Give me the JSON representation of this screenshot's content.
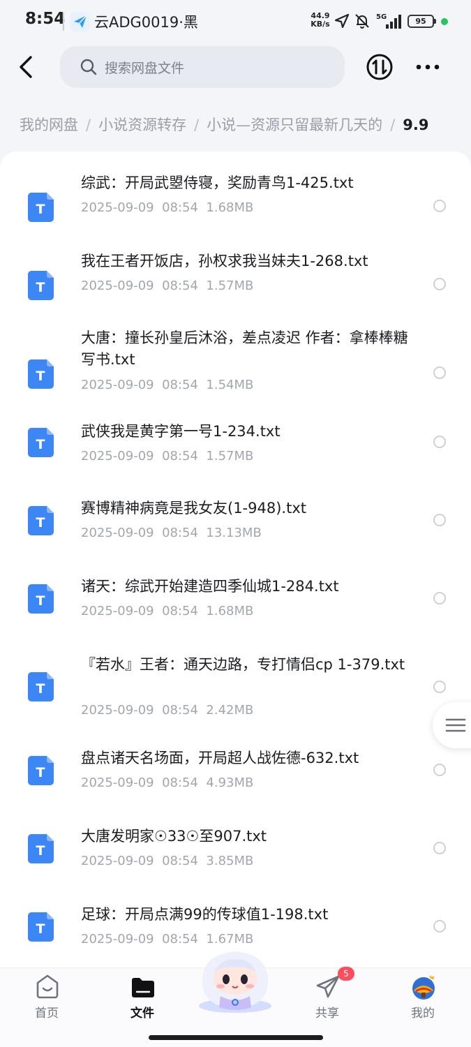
{
  "status_bar": {
    "time": "8:54",
    "app_name": "云ADG0019·黑",
    "net_speed_value": "44.9",
    "net_speed_unit": "KB/s",
    "network": "5G",
    "battery": "95"
  },
  "header": {
    "search_placeholder": "搜索网盘文件"
  },
  "breadcrumb": {
    "items": [
      "我的网盘",
      "小说资源转存",
      "小说—资源只留最新几天的"
    ],
    "separator": "/",
    "current": "9.9"
  },
  "files": [
    {
      "name": "综武：开局武曌侍寝，奖励青鸟1-425.txt",
      "date": "2025-09-09",
      "time": "08:54",
      "size": "1.68MB"
    },
    {
      "name": "我在王者开饭店，孙权求我当妹夫1-268.txt",
      "date": "2025-09-09",
      "time": "08:54",
      "size": "1.57MB"
    },
    {
      "name": "大唐：撞长孙皇后沐浴，差点凌迟 作者：拿棒棒糖写书.txt",
      "date": "2025-09-09",
      "time": "08:54",
      "size": "1.54MB"
    },
    {
      "name": "武侠我是黄字第一号1-234.txt",
      "date": "2025-09-09",
      "time": "08:54",
      "size": "1.57MB"
    },
    {
      "name": "赛博精神病竟是我女友(1-948).txt",
      "date": "2025-09-09",
      "time": "08:54",
      "size": "13.13MB"
    },
    {
      "name": "诸天：综武开始建造四季仙城1-284.txt",
      "date": "2025-09-09",
      "time": "08:54",
      "size": "1.68MB"
    },
    {
      "name": "『若水』王者：通天边路，专打情侣cp 1-379.txt",
      "date": "2025-09-09",
      "time": "08:54",
      "size": "2.42MB"
    },
    {
      "name": "盘点诸天名场面，开局超人战佐德-632.txt",
      "date": "2025-09-09",
      "time": "08:54",
      "size": "4.93MB"
    },
    {
      "name": "大唐发明家☉33☉至907.txt",
      "date": "2025-09-09",
      "time": "08:54",
      "size": "3.85MB"
    },
    {
      "name": "足球：开局点满99的传球值1-198.txt",
      "date": "2025-09-09",
      "time": "08:54",
      "size": "1.67MB"
    }
  ],
  "file_icon_letter": "T",
  "bottom_nav": {
    "items": [
      {
        "label": "首页",
        "active": false
      },
      {
        "label": "文件",
        "active": true
      },
      {
        "label": "共享",
        "active": false,
        "badge": "5"
      },
      {
        "label": "我的",
        "active": false
      }
    ]
  },
  "colors": {
    "accent": "#2f7bf5",
    "file_icon": "#3d86f6",
    "badge": "#ff4d5e",
    "status_dot": "#22c55e"
  },
  "icons": [
    "back-icon",
    "search-icon",
    "transfer-icon",
    "more-icon",
    "text-file-icon",
    "menu-icon",
    "home-icon",
    "folder-icon",
    "share-icon",
    "profile-avatar-icon",
    "mascot-icon"
  ]
}
